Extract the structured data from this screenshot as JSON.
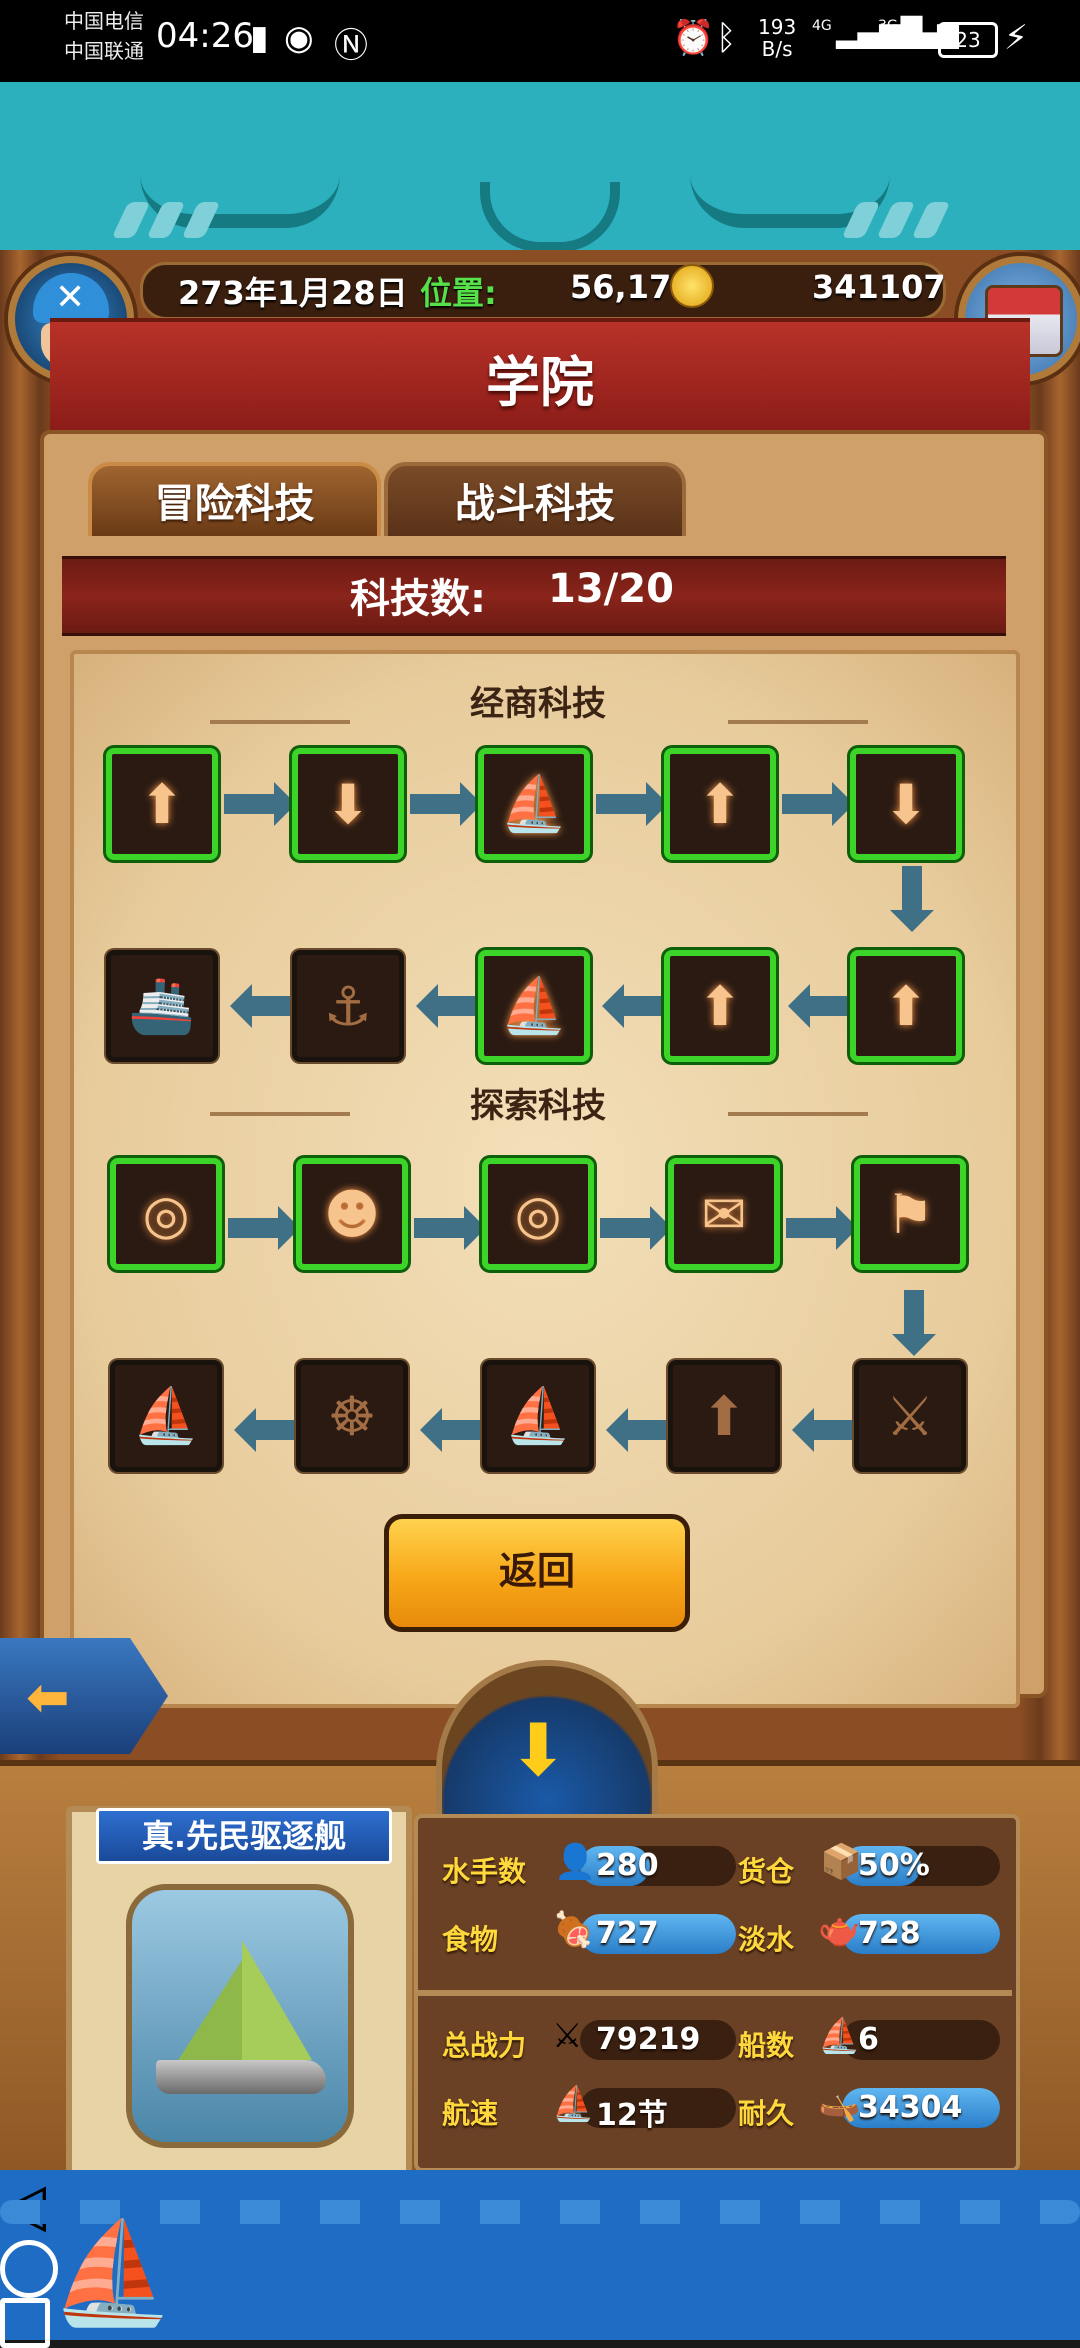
{
  "status_bar": {
    "carrier1": "中国电信",
    "carrier2": "中国联通",
    "time": "04:26",
    "net_speed_value": "193",
    "net_speed_unit": "B/s",
    "net_type_1": "4G",
    "net_type_2": "3G",
    "battery": "23"
  },
  "hud": {
    "date": "273年1月28日",
    "position_label": "位置:",
    "position_value": "56,17",
    "gold": "341107"
  },
  "title": "学院",
  "tabs": [
    "冒险科技",
    "战斗科技"
  ],
  "tech_count": {
    "label": "科技数:",
    "value": "13/20"
  },
  "sections": [
    "经商科技",
    "探索科技"
  ],
  "trade_nodes": [
    {
      "icon": "chest-up-icon",
      "glyph": "⬆",
      "unlocked": true
    },
    {
      "icon": "coins-down-icon",
      "glyph": "⬇",
      "unlocked": true
    },
    {
      "icon": "sailboat-sun-icon",
      "glyph": "⛵",
      "unlocked": true
    },
    {
      "icon": "chest-up-icon",
      "glyph": "⬆",
      "unlocked": true
    },
    {
      "icon": "coins-down-icon",
      "glyph": "⬇",
      "unlocked": true
    },
    {
      "icon": "chests-up-icon",
      "glyph": "⬆",
      "unlocked": true
    },
    {
      "icon": "chests-up-icon",
      "glyph": "⬆",
      "unlocked": true
    },
    {
      "icon": "sailboat-sun-icon",
      "glyph": "⛵",
      "unlocked": true
    },
    {
      "icon": "broken-ship-icon",
      "glyph": "⚓",
      "unlocked": false
    },
    {
      "icon": "cargo-ship-icon",
      "glyph": "🚢",
      "unlocked": false
    }
  ],
  "explore_nodes": [
    {
      "icon": "compass-icon",
      "glyph": "◎",
      "unlocked": true
    },
    {
      "icon": "crew-icon",
      "glyph": "☻",
      "unlocked": true
    },
    {
      "icon": "compass-icon",
      "glyph": "◎",
      "unlocked": true
    },
    {
      "icon": "speech-bubble-icon",
      "glyph": "✉",
      "unlocked": true
    },
    {
      "icon": "flag-icon",
      "glyph": "⚑",
      "unlocked": true
    },
    {
      "icon": "fish-sword-icon",
      "glyph": "⚔",
      "unlocked": false
    },
    {
      "icon": "fish-up-icon",
      "glyph": "⬆",
      "unlocked": false
    },
    {
      "icon": "sailboat-sun-icon",
      "glyph": "⛵",
      "unlocked": false
    },
    {
      "icon": "ship-wheel-up-icon",
      "glyph": "☸",
      "unlocked": false
    },
    {
      "icon": "galleon-icon",
      "glyph": "⛵",
      "unlocked": false
    }
  ],
  "back_button": "返回",
  "ship": {
    "name": "真.先民驱逐舰",
    "stats": {
      "sailors": {
        "label": "水手数",
        "value": "280",
        "fill": 0.45
      },
      "cargo": {
        "label": "货仓",
        "value": "50%",
        "fill": 0.5
      },
      "food": {
        "label": "食物",
        "value": "727",
        "fill": 1.0
      },
      "water": {
        "label": "淡水",
        "value": "728",
        "fill": 1.0
      },
      "power": {
        "label": "总战力",
        "value": "79219",
        "fill": 0
      },
      "ships": {
        "label": "船数",
        "value": "6",
        "fill": 0
      },
      "speed": {
        "label": "航速",
        "value": "12节",
        "fill": 0
      },
      "durability": {
        "label": "耐久",
        "value": "34304",
        "fill": 1.0
      }
    }
  }
}
